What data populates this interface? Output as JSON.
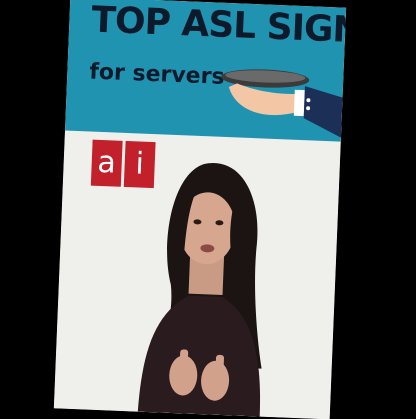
{
  "header": {
    "title": "TOP ASL SIGNS",
    "subtitle": "for servers"
  },
  "logo": {
    "letter_1": "a",
    "letter_2": "i"
  },
  "colors": {
    "banner": "#1f93b0",
    "title_text": "#0c1a2c",
    "logo_red": "#c2202a",
    "background": "#000000"
  },
  "icons": [
    "hand-holding-tray-icon"
  ]
}
